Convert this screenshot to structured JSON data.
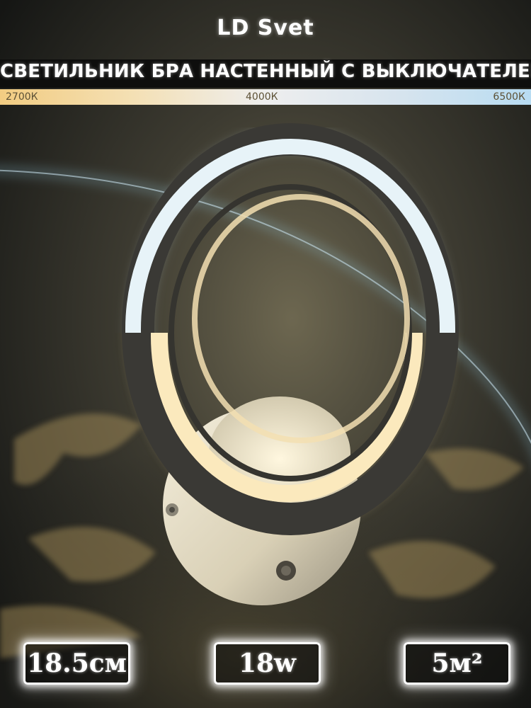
{
  "brand": {
    "name": "LD Svet"
  },
  "title": "СВЕТИЛЬНИК БРА НАСТЕННЫЙ С ВЫКЛЮЧАТЕЛЕМ",
  "color_temperatures": [
    "2700К",
    "4000К",
    "6500К"
  ],
  "specs": [
    "18.5см",
    "18w",
    "5м²"
  ],
  "colors": {
    "warm": "#f2cc82",
    "neutral": "#eeeeee",
    "cold": "#b8dcf2",
    "background": "#1b1c1a"
  }
}
